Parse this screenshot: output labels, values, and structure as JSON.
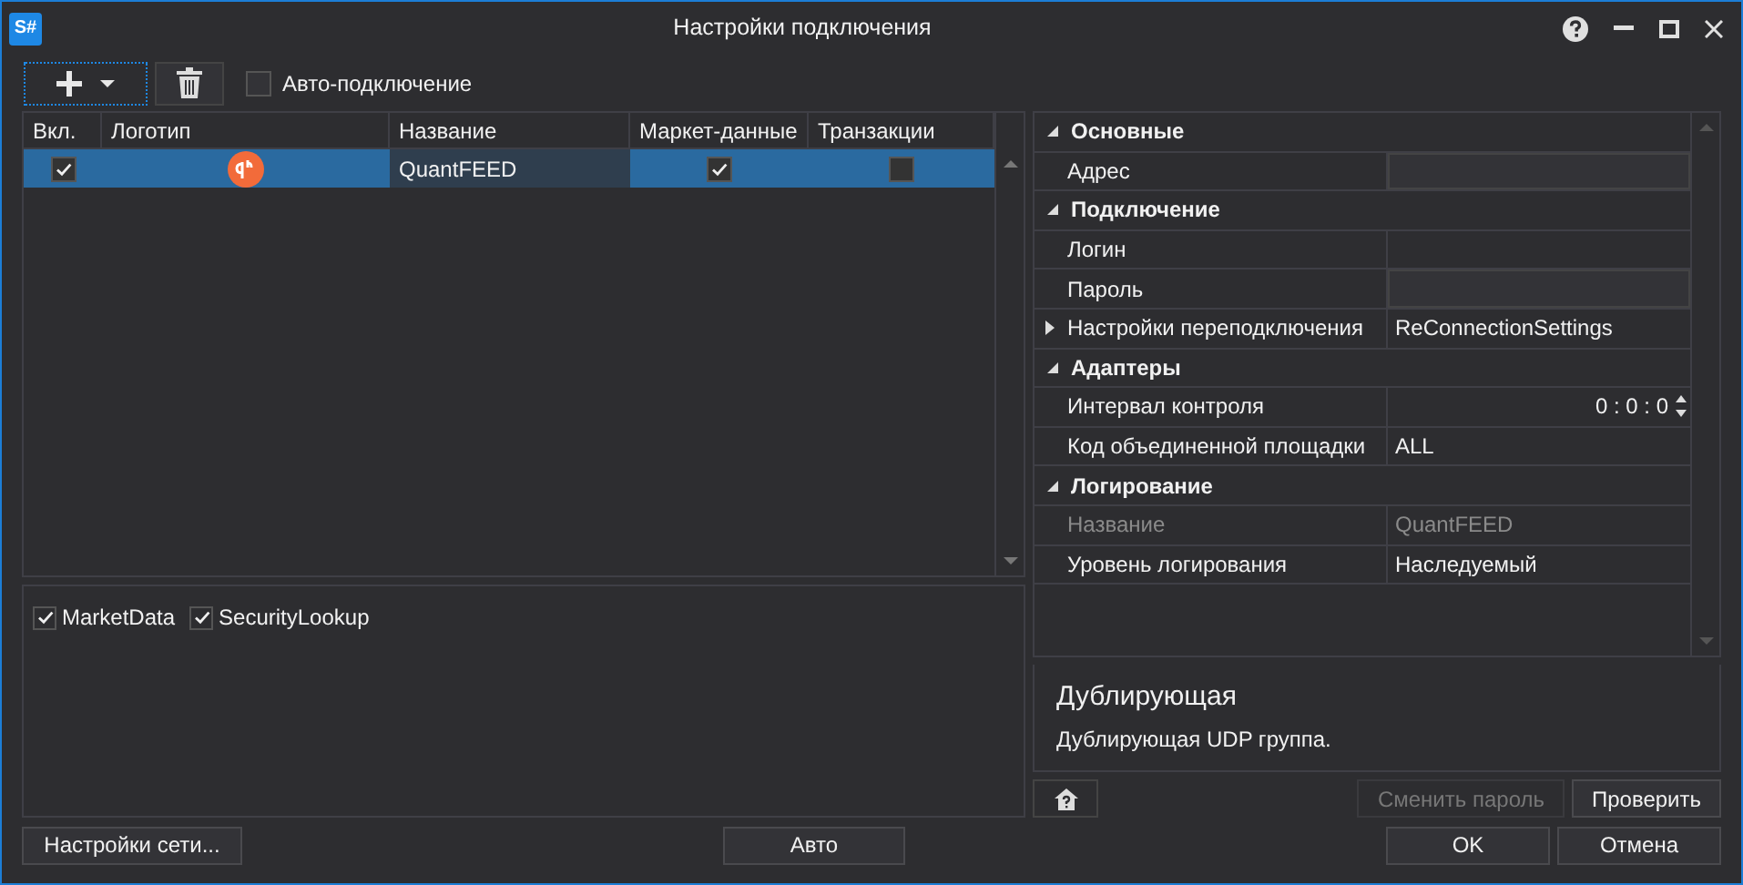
{
  "window": {
    "app_icon": "S#",
    "title": "Настройки подключения"
  },
  "toolbar": {
    "auto_connect": {
      "label": "Авто-подключение",
      "checked": false
    }
  },
  "table": {
    "columns": [
      "Вкл.",
      "Логотип",
      "Название",
      "Маркет-данные",
      "Транзакции"
    ],
    "rows": [
      {
        "enabled": true,
        "name": "QuantFEED",
        "market_data": true,
        "transactions": false,
        "selected": true
      }
    ]
  },
  "message_types": [
    {
      "label": "MarketData",
      "checked": true
    },
    {
      "label": "SecurityLookup",
      "checked": true
    }
  ],
  "properties": [
    {
      "category": "Основные",
      "expanded": true,
      "children": [
        {
          "kind": "field",
          "name": "Адрес"
        }
      ]
    },
    {
      "category": "Подключение",
      "expanded": true,
      "children": [
        {
          "kind": "text",
          "name": "Логин"
        },
        {
          "kind": "field",
          "name": "Пароль"
        },
        {
          "kind": "group",
          "name": "Настройки переподключения",
          "value": "ReConnectionSettings",
          "expanded": false
        }
      ]
    },
    {
      "category": "Адаптеры",
      "expanded": true,
      "children": [
        {
          "kind": "spin",
          "name": "Интервал контроля",
          "value": "0 : 0 : 0"
        },
        {
          "kind": "text",
          "name": "Код объединенной площадки",
          "value": "ALL"
        }
      ]
    },
    {
      "category": "Логирование",
      "expanded": true,
      "children": [
        {
          "kind": "text",
          "name": "Название",
          "value": "QuantFEED",
          "disabled": true
        },
        {
          "kind": "text",
          "name": "Уровень логирования",
          "value": "Наследуемый"
        }
      ]
    }
  ],
  "description": {
    "title": "Дублирующая",
    "text": "Дублирующая UDP группа."
  },
  "grid_buttons": [
    {
      "label": "Сменить пароль",
      "disabled": true
    },
    {
      "label": "Проверить",
      "disabled": false
    }
  ],
  "footer": {
    "network": "Настройки сети...",
    "auto": "Авто",
    "ok": "OK",
    "cancel": "Отмена"
  }
}
